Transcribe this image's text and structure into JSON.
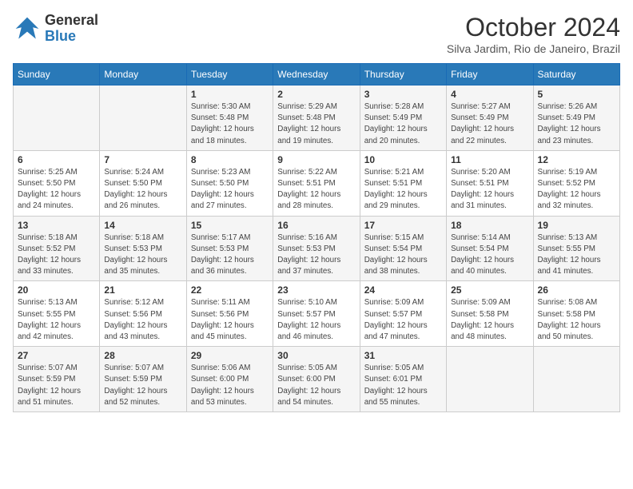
{
  "logo": {
    "line1": "General",
    "line2": "Blue"
  },
  "title": "October 2024",
  "location": "Silva Jardim, Rio de Janeiro, Brazil",
  "days_header": [
    "Sunday",
    "Monday",
    "Tuesday",
    "Wednesday",
    "Thursday",
    "Friday",
    "Saturday"
  ],
  "weeks": [
    [
      {
        "num": "",
        "info": ""
      },
      {
        "num": "",
        "info": ""
      },
      {
        "num": "1",
        "info": "Sunrise: 5:30 AM\nSunset: 5:48 PM\nDaylight: 12 hours\nand 18 minutes."
      },
      {
        "num": "2",
        "info": "Sunrise: 5:29 AM\nSunset: 5:48 PM\nDaylight: 12 hours\nand 19 minutes."
      },
      {
        "num": "3",
        "info": "Sunrise: 5:28 AM\nSunset: 5:49 PM\nDaylight: 12 hours\nand 20 minutes."
      },
      {
        "num": "4",
        "info": "Sunrise: 5:27 AM\nSunset: 5:49 PM\nDaylight: 12 hours\nand 22 minutes."
      },
      {
        "num": "5",
        "info": "Sunrise: 5:26 AM\nSunset: 5:49 PM\nDaylight: 12 hours\nand 23 minutes."
      }
    ],
    [
      {
        "num": "6",
        "info": "Sunrise: 5:25 AM\nSunset: 5:50 PM\nDaylight: 12 hours\nand 24 minutes."
      },
      {
        "num": "7",
        "info": "Sunrise: 5:24 AM\nSunset: 5:50 PM\nDaylight: 12 hours\nand 26 minutes."
      },
      {
        "num": "8",
        "info": "Sunrise: 5:23 AM\nSunset: 5:50 PM\nDaylight: 12 hours\nand 27 minutes."
      },
      {
        "num": "9",
        "info": "Sunrise: 5:22 AM\nSunset: 5:51 PM\nDaylight: 12 hours\nand 28 minutes."
      },
      {
        "num": "10",
        "info": "Sunrise: 5:21 AM\nSunset: 5:51 PM\nDaylight: 12 hours\nand 29 minutes."
      },
      {
        "num": "11",
        "info": "Sunrise: 5:20 AM\nSunset: 5:51 PM\nDaylight: 12 hours\nand 31 minutes."
      },
      {
        "num": "12",
        "info": "Sunrise: 5:19 AM\nSunset: 5:52 PM\nDaylight: 12 hours\nand 32 minutes."
      }
    ],
    [
      {
        "num": "13",
        "info": "Sunrise: 5:18 AM\nSunset: 5:52 PM\nDaylight: 12 hours\nand 33 minutes."
      },
      {
        "num": "14",
        "info": "Sunrise: 5:18 AM\nSunset: 5:53 PM\nDaylight: 12 hours\nand 35 minutes."
      },
      {
        "num": "15",
        "info": "Sunrise: 5:17 AM\nSunset: 5:53 PM\nDaylight: 12 hours\nand 36 minutes."
      },
      {
        "num": "16",
        "info": "Sunrise: 5:16 AM\nSunset: 5:53 PM\nDaylight: 12 hours\nand 37 minutes."
      },
      {
        "num": "17",
        "info": "Sunrise: 5:15 AM\nSunset: 5:54 PM\nDaylight: 12 hours\nand 38 minutes."
      },
      {
        "num": "18",
        "info": "Sunrise: 5:14 AM\nSunset: 5:54 PM\nDaylight: 12 hours\nand 40 minutes."
      },
      {
        "num": "19",
        "info": "Sunrise: 5:13 AM\nSunset: 5:55 PM\nDaylight: 12 hours\nand 41 minutes."
      }
    ],
    [
      {
        "num": "20",
        "info": "Sunrise: 5:13 AM\nSunset: 5:55 PM\nDaylight: 12 hours\nand 42 minutes."
      },
      {
        "num": "21",
        "info": "Sunrise: 5:12 AM\nSunset: 5:56 PM\nDaylight: 12 hours\nand 43 minutes."
      },
      {
        "num": "22",
        "info": "Sunrise: 5:11 AM\nSunset: 5:56 PM\nDaylight: 12 hours\nand 45 minutes."
      },
      {
        "num": "23",
        "info": "Sunrise: 5:10 AM\nSunset: 5:57 PM\nDaylight: 12 hours\nand 46 minutes."
      },
      {
        "num": "24",
        "info": "Sunrise: 5:09 AM\nSunset: 5:57 PM\nDaylight: 12 hours\nand 47 minutes."
      },
      {
        "num": "25",
        "info": "Sunrise: 5:09 AM\nSunset: 5:58 PM\nDaylight: 12 hours\nand 48 minutes."
      },
      {
        "num": "26",
        "info": "Sunrise: 5:08 AM\nSunset: 5:58 PM\nDaylight: 12 hours\nand 50 minutes."
      }
    ],
    [
      {
        "num": "27",
        "info": "Sunrise: 5:07 AM\nSunset: 5:59 PM\nDaylight: 12 hours\nand 51 minutes."
      },
      {
        "num": "28",
        "info": "Sunrise: 5:07 AM\nSunset: 5:59 PM\nDaylight: 12 hours\nand 52 minutes."
      },
      {
        "num": "29",
        "info": "Sunrise: 5:06 AM\nSunset: 6:00 PM\nDaylight: 12 hours\nand 53 minutes."
      },
      {
        "num": "30",
        "info": "Sunrise: 5:05 AM\nSunset: 6:00 PM\nDaylight: 12 hours\nand 54 minutes."
      },
      {
        "num": "31",
        "info": "Sunrise: 5:05 AM\nSunset: 6:01 PM\nDaylight: 12 hours\nand 55 minutes."
      },
      {
        "num": "",
        "info": ""
      },
      {
        "num": "",
        "info": ""
      }
    ]
  ]
}
